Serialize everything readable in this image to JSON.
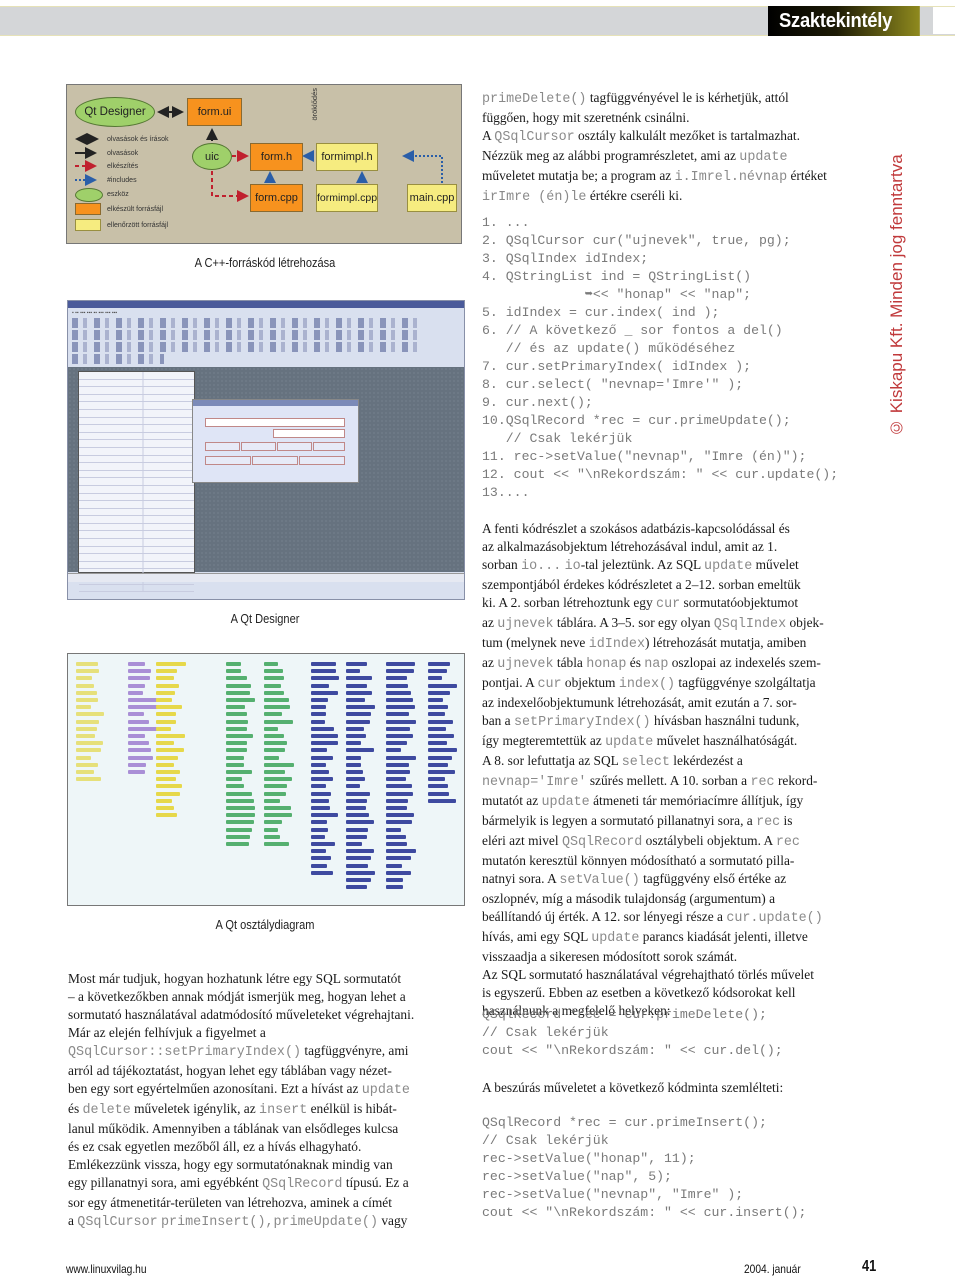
{
  "header": {
    "section_label": "Szaktekintély"
  },
  "diagram": {
    "caption": "A C++-forráskód létrehozása",
    "nodes": {
      "qt_designer": "Qt Designer",
      "form_ui": "form.ui",
      "uic": "uic",
      "form_h": "form.h",
      "form_cpp": "form.cpp",
      "formimpl_h": "formimpl.h",
      "formimpl_cpp": "formimpl.cpp",
      "main_cpp": "main.cpp"
    },
    "inheritance_label": "öröklődés",
    "legend": [
      {
        "label": "olvasások és írások",
        "kind": "double-arrow"
      },
      {
        "label": "olvasások",
        "kind": "arrow"
      },
      {
        "label": "elkészítés",
        "kind": "dashed-arrow"
      },
      {
        "label": "#includes",
        "kind": "dotted-arrow"
      },
      {
        "label": "eszköz",
        "kind": "ellipse"
      },
      {
        "label": "elkészült forrásfájl",
        "kind": "orange-box"
      },
      {
        "label": "ellenőrzött forrásfájl",
        "kind": "yellow-box"
      }
    ],
    "colors": {
      "background": "#c8c0a8",
      "generated_file": "#f7921e",
      "checked_file": "#f6ec80",
      "tool": "#9fd06a",
      "generate_arrow": "#c0202e",
      "include_arrow": "#2a5ea8"
    }
  },
  "screenshot_qt_designer": {
    "caption": "A Qt Designer"
  },
  "screenshot_class_diagram": {
    "caption": "A Qt osztálydiagram"
  },
  "right_column": {
    "intro": [
      [
        {
          "t": "primeDelete()",
          "c": true
        },
        {
          "t": " tagfüggvényével le is kérhetjük, attól"
        }
      ],
      [
        {
          "t": "függően, hogy mit szeretnénk csinálni."
        }
      ],
      [
        {
          "t": "A "
        },
        {
          "t": "QSqlCursor",
          "c": true
        },
        {
          "t": " osztály kalkulált mezőket is tartalmazhat."
        }
      ],
      [
        {
          "t": "Nézzük meg az alábbi programrészletet, ami az "
        },
        {
          "t": "update",
          "c": true
        }
      ],
      [
        {
          "t": "műveletet mutatja be; a program az "
        },
        {
          "t": "i.Imrel.névnap",
          "c": true
        },
        {
          "t": " értéket"
        }
      ],
      [
        {
          "t": "irImre (én)le",
          "c": true
        },
        {
          "t": " értékre cseréli ki."
        }
      ]
    ],
    "code_listing": [
      "1. ...",
      "2. QSqlCursor cur(\"ujnevek\", true, pg);",
      "3. QSqlIndex idIndex;",
      "4. QStringList ind = QStringList()",
      "             ➥<< \"honap\" << \"nap\";",
      "5. idIndex = cur.index( ind );",
      "6. // A következő _ sor fontos a del()",
      "   // és az update() működéséhez",
      "7. cur.setPrimaryIndex( idIndex );",
      "8. cur.select( \"nevnap='Imre'\" );",
      "9. cur.next();",
      "10.QSqlRecord *rec = cur.primeUpdate();",
      "   // Csak lekérjük",
      "11. rec->setValue(\"nevnap\", \"Imre (én)\");",
      "12. cout << \"\\nRekordszám: \" << cur.update();",
      "13...."
    ],
    "explanation": [
      [
        {
          "t": "A fenti kódrészlet a szokásos adatbázis-kapcsolódással és"
        }
      ],
      [
        {
          "t": "az alkalmazásobjektum létrehozásával indul, amit az 1."
        }
      ],
      [
        {
          "t": "sorban "
        },
        {
          "t": "io...",
          "c": true
        },
        {
          "t": " "
        },
        {
          "t": "io",
          "c": true
        },
        {
          "t": "-tal jeleztünk. Az SQL "
        },
        {
          "t": "update",
          "c": true
        },
        {
          "t": " művelet"
        }
      ],
      [
        {
          "t": "szempontjából érdekes kódrészletet a 2–12. sorban emeltük"
        }
      ],
      [
        {
          "t": "ki. A 2. sorban létrehoztunk egy "
        },
        {
          "t": "cur",
          "c": true
        },
        {
          "t": " sormutatóobjektumot"
        }
      ],
      [
        {
          "t": "az "
        },
        {
          "t": "ujnevek",
          "c": true
        },
        {
          "t": " táblára. A 3–5. sor egy olyan "
        },
        {
          "t": "QSqlIndex",
          "c": true
        },
        {
          "t": " objek-"
        }
      ],
      [
        {
          "t": "tum (melynek neve "
        },
        {
          "t": "idIndex",
          "c": true
        },
        {
          "t": ") létrehozását mutatja, amiben"
        }
      ],
      [
        {
          "t": "az "
        },
        {
          "t": "ujnevek",
          "c": true
        },
        {
          "t": " tábla "
        },
        {
          "t": "honap",
          "c": true
        },
        {
          "t": " és "
        },
        {
          "t": "nap",
          "c": true
        },
        {
          "t": " oszlopai az indexelés szem-"
        }
      ],
      [
        {
          "t": "pontjai. A "
        },
        {
          "t": "cur",
          "c": true
        },
        {
          "t": " objektum "
        },
        {
          "t": "index()",
          "c": true
        },
        {
          "t": " tagfüggvénye szolgáltatja"
        }
      ],
      [
        {
          "t": "az indexelőobjektumunk létrehozását, amit ezután a 7. sor-"
        }
      ],
      [
        {
          "t": "ban a "
        },
        {
          "t": "setPrimaryIndex()",
          "c": true
        },
        {
          "t": " hívásban használni tudunk,"
        }
      ],
      [
        {
          "t": "így megteremtettük az "
        },
        {
          "t": "update",
          "c": true
        },
        {
          "t": " művelet használhatóságát."
        }
      ],
      [
        {
          "t": "A 8. sor lefuttatja az SQL "
        },
        {
          "t": "select",
          "c": true
        },
        {
          "t": " lekérdezést a"
        }
      ],
      [
        {
          "t": "nevnap='Imre'",
          "c": true
        },
        {
          "t": " szűrés mellett. A 10. sorban a "
        },
        {
          "t": "rec",
          "c": true
        },
        {
          "t": " rekord-"
        }
      ],
      [
        {
          "t": "mutatót az "
        },
        {
          "t": "update",
          "c": true
        },
        {
          "t": " átmeneti tár memóriacímre állítjuk, így"
        }
      ],
      [
        {
          "t": "bármelyik is legyen a sormutató pillanatnyi sora, a "
        },
        {
          "t": "rec",
          "c": true
        },
        {
          "t": " is"
        }
      ],
      [
        {
          "t": "eléri azt mivel "
        },
        {
          "t": "QSqlRecord",
          "c": true
        },
        {
          "t": " osztálybeli objektum. A "
        },
        {
          "t": "rec",
          "c": true
        }
      ],
      [
        {
          "t": "mutatón keresztül könnyen módosítható a sormutató pilla-"
        }
      ],
      [
        {
          "t": "natnyi sora. A "
        },
        {
          "t": "setValue()",
          "c": true
        },
        {
          "t": " tagfüggvény első értéke az"
        }
      ],
      [
        {
          "t": "oszlopnév, míg a második tulajdonság (argumentum) a"
        }
      ],
      [
        {
          "t": "beállítandó új érték. A 12. sor lényegi része a "
        },
        {
          "t": "cur.update()",
          "c": true
        }
      ],
      [
        {
          "t": "hívás, ami egy SQL "
        },
        {
          "t": "update",
          "c": true
        },
        {
          "t": " parancs kiadását jelenti, illetve"
        }
      ],
      [
        {
          "t": "visszaadja a sikeresen módosított sorok számát."
        }
      ],
      [
        {
          "t": "Az SQL sormutató használatával végrehajtható törlés művelet"
        }
      ],
      [
        {
          "t": "is egyszerű. Ebben az esetben a következő kódsorokat kell"
        }
      ],
      [
        {
          "t": "használnunk a megfelelő helyeken:"
        }
      ]
    ],
    "delete_code": [
      "QSqlRecord *rec = cur.primeDelete();",
      "// Csak lekérjük",
      "cout << \"\\nRekordszám: \" << cur.del();"
    ],
    "insert_intro": "A beszúrás műveletet a következő kódminta szemlélteti:",
    "insert_code": [
      "QSqlRecord *rec = cur.primeInsert();",
      "// Csak lekérjük",
      "rec->setValue(\"honap\", 11);",
      "rec->setValue(\"nap\", 5);",
      "rec->setValue(\"nevnap\", \"Imre\" );",
      "cout << \"\\nRekordszám: \" << cur.insert();"
    ]
  },
  "left_column": {
    "body": [
      [
        {
          "t": "Most már tudjuk, hogyan hozhatunk létre egy SQL sormutatót"
        }
      ],
      [
        {
          "t": "– a következőkben annak módját ismerjük meg, hogyan lehet a"
        }
      ],
      [
        {
          "t": "sormutató használatával adatmódosító műveleteket végrehajtani."
        }
      ],
      [
        {
          "t": "Már az elején felhívjuk a figyelmet a"
        }
      ],
      [
        {
          "t": "QSqlCursor::setPrimaryIndex()",
          "c": true
        },
        {
          "t": " tagfüggvényre, ami"
        }
      ],
      [
        {
          "t": "arról ad tájékoztatást, hogyan lehet egy táblában vagy nézet-"
        }
      ],
      [
        {
          "t": "ben egy sort egyértelműen azonosítani. Ezt a hívást az "
        },
        {
          "t": "update",
          "c": true
        }
      ],
      [
        {
          "t": "és "
        },
        {
          "t": "delete",
          "c": true
        },
        {
          "t": " műveletek igénylik, az "
        },
        {
          "t": "insert",
          "c": true
        },
        {
          "t": " enélkül is hibát-"
        }
      ],
      [
        {
          "t": "lanul működik. Amennyiben a táblának van elsődleges kulcsa"
        }
      ],
      [
        {
          "t": "és ez csak egyetlen mezőből áll, ez a hívás elhagyható."
        }
      ],
      [
        {
          "t": "Emlékezzünk vissza, hogy egy sormutatónaknak mindig van"
        }
      ],
      [
        {
          "t": "egy pillanatnyi sora, ami egyébként "
        },
        {
          "t": "QSqlRecord",
          "c": true
        },
        {
          "t": " típusú. Ez a"
        }
      ],
      [
        {
          "t": "sor egy átmenetitár-területen van létrehozva, aminek a címét"
        }
      ],
      [
        {
          "t": "a "
        },
        {
          "t": "QSqlCursor",
          "c": true
        },
        {
          "t": " "
        },
        {
          "t": "primeInsert(),primeUpdate()",
          "c": true
        },
        {
          "t": " vagy"
        }
      ]
    ]
  },
  "side_note": {
    "copyright": "© Kiskapu Kft. Minden jog fenntartva",
    "color": "#c0393b"
  },
  "footer": {
    "url": "www.linuxvilag.hu",
    "date": "2004. január",
    "page_number": "41"
  }
}
